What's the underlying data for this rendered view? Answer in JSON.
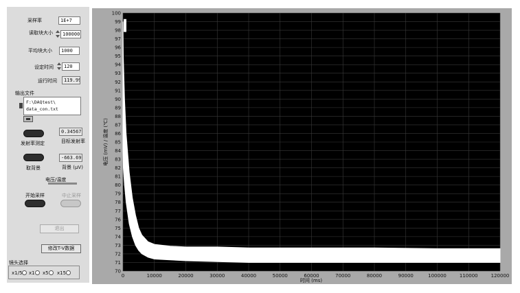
{
  "controls": {
    "sample_rate": {
      "label": "采样率",
      "value": "1E+7"
    },
    "read_block_size": {
      "label": "读取块大小",
      "value": "100000"
    },
    "avg_block_size": {
      "label": "平均块大小",
      "value": "1000"
    },
    "set_time": {
      "label": "设定时间",
      "value": "120"
    },
    "run_time": {
      "label": "运行时间",
      "value": "119.99"
    },
    "output_file": {
      "label": "输出文件",
      "line1": "F:\\DAQtest\\",
      "line2": "data_con.txt"
    },
    "emissivity": {
      "button_label": "发射率测定",
      "value": "0.34567",
      "label": "目标发射率"
    },
    "background": {
      "button_label": "取背景",
      "value": "-663.69",
      "label": "背景 (μV)"
    },
    "voltage_temp_label": "电压/温度",
    "start_label": "开始采样",
    "stop_label": "中止采样",
    "exit_label": "退出",
    "modify_label": "修改T-V数据",
    "lens": {
      "label": "镜头选择",
      "options": [
        "x1/5",
        "x1",
        "x5",
        "x15"
      ]
    }
  },
  "chart_data": {
    "type": "line",
    "xlabel": "时间 (ms)",
    "ylabel": "电压 (mV) / 温度 (℃)",
    "xlim": [
      0,
      120000
    ],
    "ylim": [
      70,
      100
    ],
    "x_ticks": [
      0,
      10000,
      20000,
      30000,
      40000,
      50000,
      60000,
      70000,
      80000,
      90000,
      100000,
      110000,
      120000
    ],
    "y_ticks": [
      70,
      71,
      72,
      73,
      74,
      75,
      76,
      77,
      78,
      79,
      80,
      81,
      82,
      83,
      84,
      85,
      86,
      87,
      88,
      89,
      90,
      91,
      92,
      93,
      94,
      95,
      96,
      97,
      98,
      99,
      100
    ],
    "grid": true,
    "series_color": "#ffffff",
    "background_color": "#000000",
    "series": [
      {
        "x": [
          0,
          100,
          500,
          1000,
          2000,
          3000,
          4000,
          5000,
          6000,
          8000,
          10000,
          15000,
          20000,
          30000,
          40000,
          60000,
          80000,
          100000,
          120000
        ],
        "upper": [
          99,
          95,
          90,
          86,
          81.5,
          78.5,
          76.5,
          75,
          74.2,
          73.4,
          73.1,
          72.9,
          72.8,
          72.8,
          72.7,
          72.7,
          72.7,
          72.6,
          72.6
        ],
        "lower": [
          84,
          82,
          80,
          78,
          75.5,
          74,
          73,
          72.4,
          72.0,
          71.6,
          71.4,
          71.3,
          71.2,
          71.1,
          71.0,
          71.0,
          71.0,
          71.0,
          71.0
        ]
      }
    ],
    "cursor": {
      "x": 0,
      "y_top": 99.3,
      "y_bottom": 97.8
    }
  }
}
